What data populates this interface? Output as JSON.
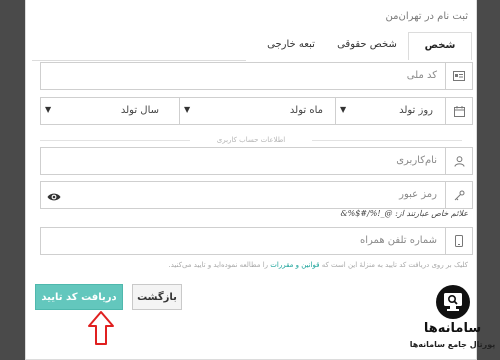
{
  "form": {
    "title": "ثبت نام در تهران‌من",
    "tabs": [
      {
        "label": "شخص حقیقی",
        "active": true
      },
      {
        "label": "شخص حقوقی",
        "active": false
      },
      {
        "label": "تبعه خارجی",
        "active": false
      }
    ],
    "national_code_placeholder": "کد ملی",
    "birth": {
      "day_placeholder": "روز تولد",
      "month_placeholder": "ماه تولد",
      "year_placeholder": "سال تولد"
    },
    "account_section_label": "اطلاعات حساب کاربری",
    "username_placeholder": "نام‌کاربری",
    "password_placeholder": "رمز عبور",
    "password_hint": "علائم خاص عبارتند از: @_!%/#$%&",
    "phone_placeholder": "شماره تلفن همراه",
    "terms": {
      "before": "کلیک بر روی دریافت کد تایید به منزلهٔ این است که",
      "link": "قوانین و مقررات",
      "after": "را مطالعه نموده‌اید و تایید می‌کنید."
    },
    "buttons": {
      "get_code": "دریافت کد تایید",
      "back": "بازگشت"
    }
  },
  "brand": {
    "name": "سامانه‌ها",
    "tagline": "پورتال جامع سامانه‌ها"
  },
  "colors": {
    "primary_button": "#63c7bd",
    "link": "#1aa39a",
    "arrow": "#e02020"
  },
  "icons": [
    "id-card-icon",
    "calendar-icon",
    "user-icon",
    "key-icon",
    "eye-icon",
    "mobile-icon",
    "chevron-down-icon",
    "arrow-up-icon",
    "search-monitor-icon"
  ]
}
